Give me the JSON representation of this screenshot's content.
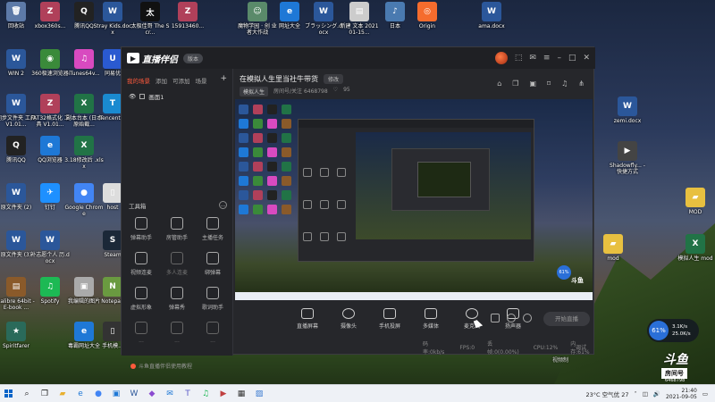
{
  "desktop": {
    "icons_left": [
      {
        "label": "回收站",
        "glyph": "🗑",
        "color": "#5d7aa8"
      },
      {
        "label": "xbox360s...",
        "glyph": "Z",
        "color": "#b0405a"
      },
      {
        "label": "腾讯QQ",
        "glyph": "Q",
        "color": "#222"
      },
      {
        "label": "Stray Kids.docx",
        "glyph": "W",
        "color": "#2b579a"
      },
      {
        "label": "太极佳哥 The Scr...",
        "glyph": "太",
        "color": "#111"
      },
      {
        "label": "15913460...",
        "glyph": "Z",
        "color": "#b0405a"
      },
      {
        "label": "WIN 2",
        "glyph": "W",
        "color": "#2b579a"
      },
      {
        "label": "360极速浏览器",
        "glyph": "◉",
        "color": "#3a8a3a"
      },
      {
        "label": "iTunes64v...",
        "glyph": "♫",
        "color": "#d84ac0"
      },
      {
        "label": "同易优",
        "glyph": "U",
        "color": "#2a5ad0"
      },
      {
        "label": "同步文件夹 工具 V1.01...",
        "glyph": "W",
        "color": "#2b579a"
      },
      {
        "label": "FAT32格式化 工具 V1.01...",
        "glyph": "Z",
        "color": "#b0405a"
      },
      {
        "label": "副本台本 (日本原始截...",
        "glyph": "X",
        "color": "#217346"
      },
      {
        "label": "Tencent...",
        "glyph": "T",
        "color": "#1a8ad0"
      },
      {
        "label": "腾讯QQ",
        "glyph": "Q",
        "color": "#222"
      },
      {
        "label": "QQ浏览器",
        "glyph": "e",
        "color": "#1e78d6"
      },
      {
        "label": "3.18修改后 .xlsx",
        "glyph": "X",
        "color": "#217346"
      },
      {
        "label": "原文件夹 (2)",
        "glyph": "W",
        "color": "#2b579a"
      },
      {
        "label": "钉钉",
        "glyph": "✈",
        "color": "#1e90ff"
      },
      {
        "label": "Google Chrome",
        "glyph": "●",
        "color": "#4285f4"
      },
      {
        "label": "host",
        "glyph": "▯",
        "color": "#ddd"
      },
      {
        "label": "原文件夹 (3)",
        "glyph": "W",
        "color": "#2b579a"
      },
      {
        "label": "补志愿个人 历.docx",
        "glyph": "W",
        "color": "#2b579a"
      },
      {
        "label": "Steam",
        "glyph": "S",
        "color": "#1b2838"
      },
      {
        "label": "calibre 64bit - E-book ...",
        "glyph": "▤",
        "color": "#8a5a2a"
      },
      {
        "label": "Spotify",
        "glyph": "♫",
        "color": "#1db954"
      },
      {
        "label": "我编辑的图片",
        "glyph": "▣",
        "color": "#aaa"
      },
      {
        "label": "Notepad",
        "glyph": "N",
        "color": "#6a9a40"
      },
      {
        "label": "Spiritfarer",
        "glyph": "★",
        "color": "#2a6a5a"
      },
      {
        "label": "毒霸网址大全",
        "glyph": "e",
        "color": "#1e78d6"
      },
      {
        "label": "手机模...",
        "glyph": "▯",
        "color": "#333"
      }
    ],
    "icons_top": [
      {
        "label": "魔物学园 · 创 业者大作战",
        "glyph": "☺",
        "color": "#5a8a6a"
      },
      {
        "label": "网址大全",
        "glyph": "e",
        "color": "#1e78d6"
      },
      {
        "label": "ブラッシング.docx",
        "glyph": "W",
        "color": "#2b579a"
      },
      {
        "label": "新建 文本 2021 01-15...",
        "glyph": "▤",
        "color": "#ccc"
      },
      {
        "label": "日本",
        "glyph": "♪",
        "color": "#4a7ab0"
      },
      {
        "label": "Origin",
        "glyph": "◎",
        "color": "#f56c2d"
      },
      {
        "label": "ama.docx",
        "glyph": "W",
        "color": "#2b579a"
      }
    ],
    "icons_right": [
      {
        "label": "zemi.docx",
        "glyph": "W",
        "color": "#2b579a"
      },
      {
        "label": "Shadowfly... - 快捷方式",
        "glyph": "▶",
        "color": "#444"
      },
      {
        "label": "MOD",
        "glyph": "▰",
        "color": "#e8c040"
      },
      {
        "label": "mod",
        "glyph": "▰",
        "color": "#e8c040"
      },
      {
        "label": "模拟人生 mod",
        "glyph": "X",
        "color": "#217346"
      }
    ]
  },
  "app": {
    "name": "直播伴侣",
    "version_badge": "版本",
    "tabs": [
      "我的场景",
      "添加",
      "可添加",
      "场景"
    ],
    "scene_label": "画面1",
    "room_title": "在模拟人生里当社牛带货",
    "edit_label": "修改",
    "category_tag": "模拟人生",
    "meta_text": "房间号/关注 6468798",
    "fans_count": "95",
    "toolbox_label": "工具箱",
    "tools": [
      {
        "label": "弹幕助手",
        "dim": false
      },
      {
        "label": "房管助手",
        "dim": false
      },
      {
        "label": "主播任务",
        "dim": false
      },
      {
        "label": "视频连麦",
        "dim": false
      },
      {
        "label": "多人连麦",
        "dim": true
      },
      {
        "label": "绑弹幕",
        "dim": false
      },
      {
        "label": "虚拟形象",
        "dim": false
      },
      {
        "label": "弹幕秀",
        "dim": false
      },
      {
        "label": "歌词助手",
        "dim": false
      },
      {
        "label": "...",
        "dim": true
      },
      {
        "label": "...",
        "dim": true
      },
      {
        "label": "...",
        "dim": true
      }
    ],
    "notice": "斗鱼直播伴侣使用教程",
    "controls": [
      "直播屏幕",
      "摄像头",
      "手机投屏",
      "多媒体",
      "麦克风",
      "扬声器"
    ],
    "go_live": "开始直播",
    "status": [
      "码率:0kb/s",
      "FPS:0",
      "丢帧:0(0.00%)",
      "CPU:12%",
      "内存:61%"
    ],
    "status_right": "调试",
    "preview_watermark": "斗鱼"
  },
  "overlay": {
    "net_percent": "61%",
    "up_speed": "3.1K/s",
    "down_speed": "25.0K/s",
    "brand": "斗鱼",
    "room_label": "房间号",
    "room_no": "6468798",
    "video_text": "视频制"
  },
  "taskbar": {
    "weather": "23°C 空气优 27",
    "time": "21:40",
    "date": "2021-09-05"
  }
}
